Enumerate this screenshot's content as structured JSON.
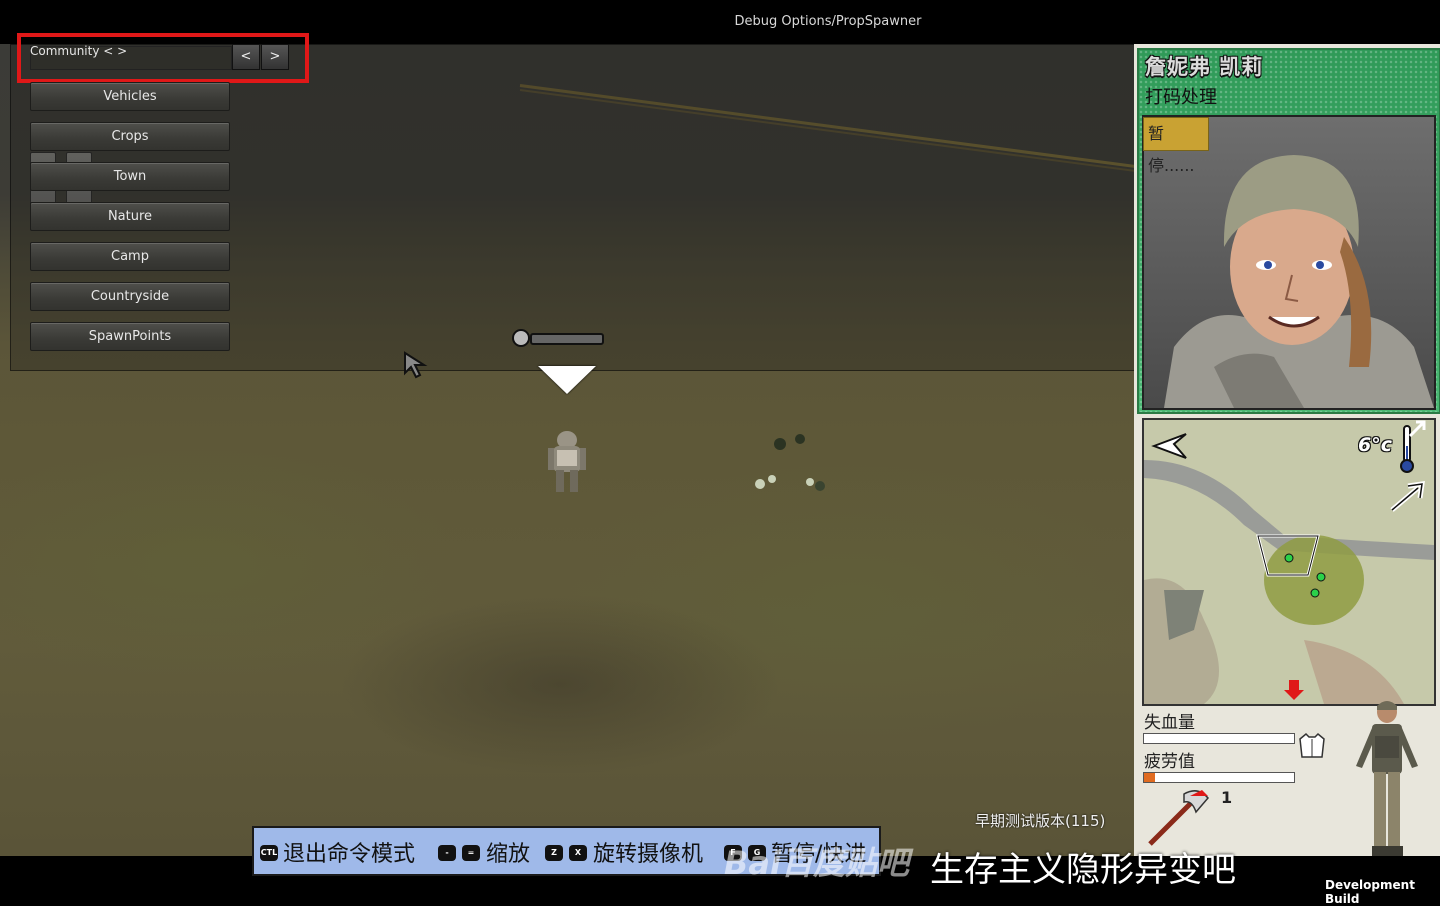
{
  "window": {
    "title": "Debug Options/PropSpawner"
  },
  "debug_panel": {
    "community_label": "Community <  >",
    "prev_label": "<",
    "next_label": ">",
    "categories": [
      "Vehicles",
      "Crops",
      "Town",
      "Nature",
      "Camp",
      "Countryside",
      "SpawnPoints"
    ]
  },
  "character": {
    "name": "詹妮弗 凯莉",
    "status": "打码处理",
    "paused_badge": "暂停......"
  },
  "minimap": {
    "temperature": "6°c"
  },
  "stats": {
    "blood_loss_label": "失血量",
    "blood_loss_level": 0,
    "fatigue_label": "疲劳值",
    "fatigue_level": 0.07,
    "weapon_count": "1"
  },
  "version_label": "早期测试版本(115)",
  "dev_build_label": "Development Build",
  "hints": {
    "exit_key": "CTL",
    "exit_label": "退出命令模式",
    "zoom_key_1": "-",
    "zoom_key_2": "=",
    "zoom_label": "缩放",
    "rotate_key_1": "Z",
    "rotate_key_2": "X",
    "rotate_label": "旋转摄像机",
    "pause_key_1": "F",
    "pause_key_2": "G",
    "pause_label": "暂停/快进"
  },
  "watermark": {
    "logo": "Bai百度贴吧",
    "text": "生存主义隐形异变吧"
  },
  "colors": {
    "highlight": "#e01818",
    "portrait_bg": "#3fae68",
    "hint_bar": "#9fb9e9",
    "fatigue_fill": "#e06b20"
  }
}
